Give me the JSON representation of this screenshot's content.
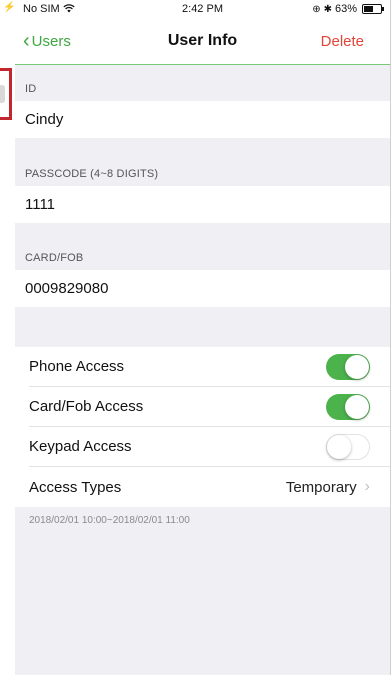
{
  "statusbar": {
    "carrier": "No SIM",
    "time": "2:42 PM",
    "battery_percent": "63%",
    "battery_level": 0.63
  },
  "navbar": {
    "back_label": "Users",
    "title": "User Info",
    "delete_label": "Delete"
  },
  "fields": {
    "id": {
      "label": "ID",
      "value": "Cindy"
    },
    "passcode": {
      "label": "PASSCODE (4~8 DIGITS)",
      "value": "1111"
    },
    "card": {
      "label": "CARD/FOB",
      "value": "0009829080"
    }
  },
  "access": {
    "phone": {
      "label": "Phone Access",
      "enabled": true
    },
    "card": {
      "label": "Card/Fob Access",
      "enabled": true
    },
    "keypad": {
      "label": "Keypad Access",
      "enabled": false
    },
    "types": {
      "label": "Access Types",
      "value": "Temporary"
    }
  },
  "date_range": "2018/02/01 10:00~2018/02/01 11:00",
  "colors": {
    "accent_green": "#3fa73f",
    "toggle_on": "#4cb24c",
    "delete_red": "#e0453a",
    "background": "#efeff4"
  }
}
